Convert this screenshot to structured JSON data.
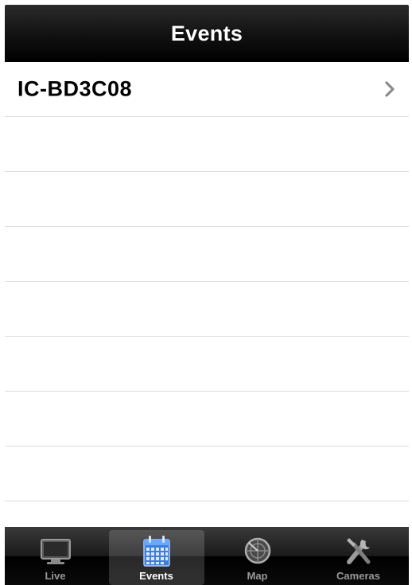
{
  "navbar": {
    "title": "Events"
  },
  "list": {
    "items": [
      {
        "label": "IC-BD3C08",
        "has_chevron": true
      }
    ],
    "empty_rows": 7
  },
  "tabbar": {
    "tabs": [
      {
        "label": "Live",
        "icon": "tv-icon",
        "active": false
      },
      {
        "label": "Events",
        "icon": "calendar-icon",
        "active": true
      },
      {
        "label": "Map",
        "icon": "radar-icon",
        "active": false
      },
      {
        "label": "Cameras",
        "icon": "tools-icon",
        "active": false
      }
    ]
  },
  "colors": {
    "navbar_bg": "#111111",
    "tab_active_icon": "#6aa8ff",
    "tab_inactive_icon": "#8a8a8a",
    "separator": "#dcdcdc",
    "chevron": "#8c8c8c"
  }
}
